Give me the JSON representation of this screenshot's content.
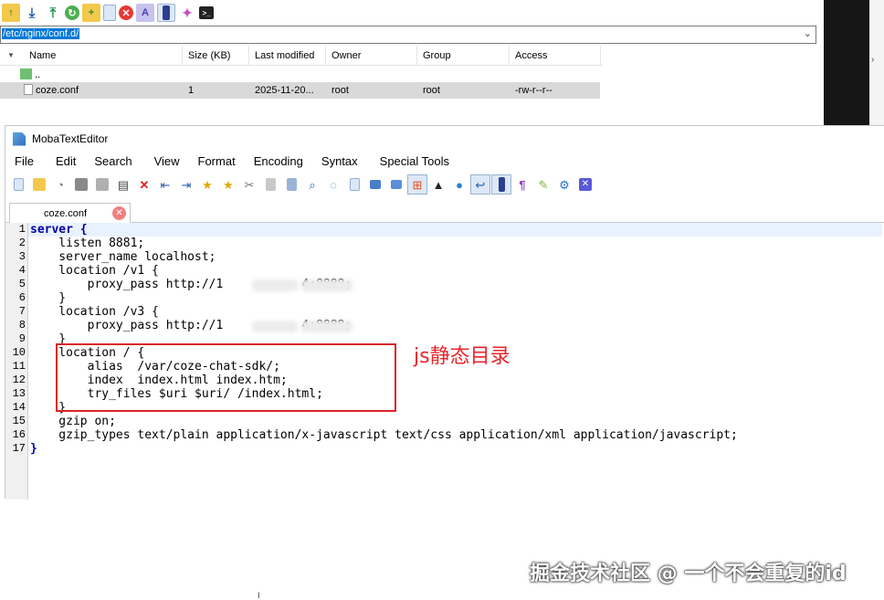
{
  "file_browser": {
    "toolbar_icons": [
      "parent-folder-icon",
      "download-icon",
      "upload-icon",
      "refresh-icon",
      "new-folder-icon",
      "new-file-icon",
      "delete-icon",
      "rename-icon",
      "text-editor-icon",
      "magic-wand-icon",
      "terminal-icon"
    ],
    "path": "/etc/nginx/conf.d/",
    "columns": [
      "Name",
      "Size (KB)",
      "Last modified",
      "Owner",
      "Group",
      "Access"
    ],
    "rows": [
      {
        "name": "..",
        "size": "",
        "modified": "",
        "owner": "",
        "group": "",
        "access": ""
      },
      {
        "name": "coze.conf",
        "size": "1",
        "modified": "2025-11-20...",
        "owner": "root",
        "group": "root",
        "access": "-rw-r--r--"
      }
    ]
  },
  "editor": {
    "title": "MobaTextEditor",
    "menu": [
      "File",
      "Edit",
      "Search",
      "View",
      "Format",
      "Encoding",
      "Syntax",
      "Special Tools"
    ],
    "tab": {
      "label": "coze.conf"
    },
    "lines": [
      {
        "num": "1",
        "text": "server {"
      },
      {
        "num": "2",
        "text": "    listen 8881;"
      },
      {
        "num": "3",
        "text": "    server_name localhost;"
      },
      {
        "num": "4",
        "text": "    location /v1 {"
      },
      {
        "num": "5",
        "text": "        proxy_pass http://1           4:8888;"
      },
      {
        "num": "6",
        "text": "    }"
      },
      {
        "num": "7",
        "text": "    location /v3 {"
      },
      {
        "num": "8",
        "text": "        proxy_pass http://1           4:8888;"
      },
      {
        "num": "9",
        "text": "    }"
      },
      {
        "num": "10",
        "text": "    location / {"
      },
      {
        "num": "11",
        "text": "        alias  /var/coze-chat-sdk/;"
      },
      {
        "num": "12",
        "text": "        index  index.html index.htm;"
      },
      {
        "num": "13",
        "text": "        try_files $uri $uri/ /index.html;"
      },
      {
        "num": "14",
        "text": "    }"
      },
      {
        "num": "15",
        "text": "    gzip on;"
      },
      {
        "num": "16",
        "text": "    gzip_types text/plain application/x-javascript text/css application/xml application/javascript;"
      },
      {
        "num": "17",
        "text": "}"
      }
    ],
    "annotation": "js静态目录",
    "watermark": "掘金技术社区 @ 一个不会重复的id"
  },
  "colors": {
    "selection": "#0078d7",
    "highlight_box": "#d9262b",
    "annotation": "#e8262b",
    "keyword": "#0000a0"
  }
}
